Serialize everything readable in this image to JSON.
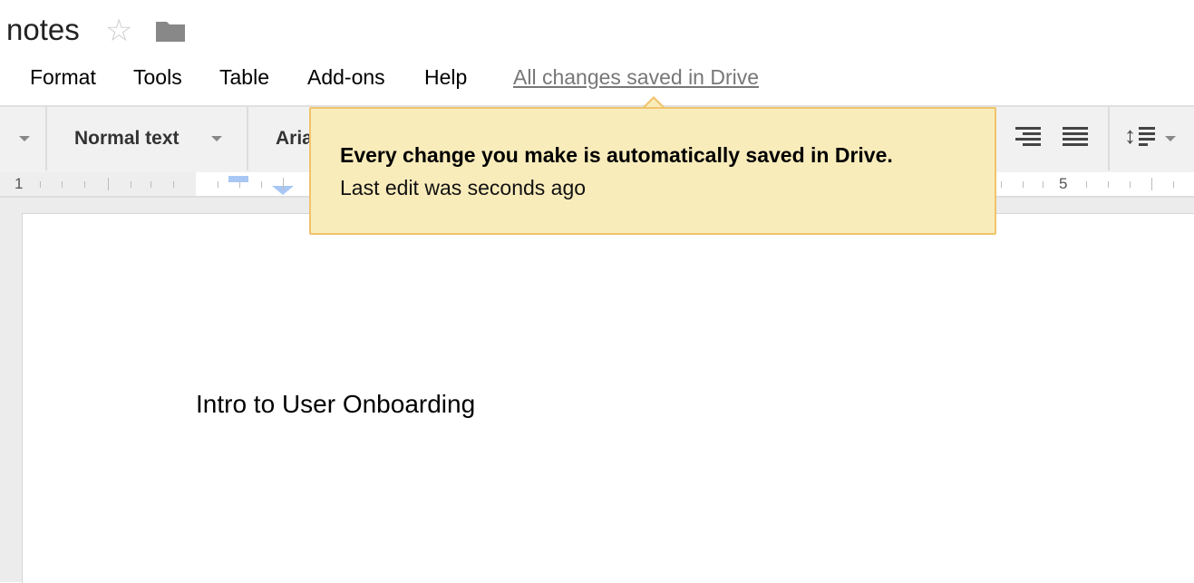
{
  "doc": {
    "title": "notes",
    "star_icon": "star-icon",
    "folder_icon": "folder-icon"
  },
  "menu": [
    "Format",
    "Tools",
    "Table",
    "Add-ons",
    "Help"
  ],
  "save_status": "All changes saved in Drive",
  "toolbar": {
    "style": "Normal text",
    "font": "Aria"
  },
  "ruler": {
    "labels": [
      "1",
      "5"
    ]
  },
  "tooltip": {
    "heading": "Every change you make is automatically saved in Drive.",
    "subtext": "Last edit was seconds ago",
    "bg": "#f9ecbb",
    "border": "#f0c36d"
  },
  "body": {
    "text": "Intro to User Onboarding"
  }
}
